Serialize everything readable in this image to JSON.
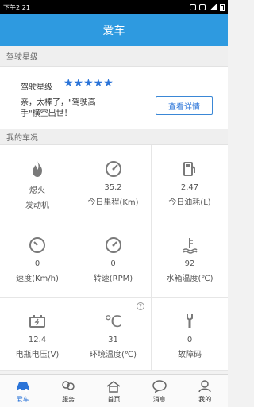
{
  "status_bar": {
    "time": "下午2:21"
  },
  "app_bar": {
    "title": "爱车"
  },
  "sections": {
    "driving_star": "驾驶星级",
    "my_car_status": "我的车况"
  },
  "star_panel": {
    "label": "驾驶星级",
    "stars": "★★★★★",
    "rating": 5,
    "message": "亲，太棒了，\"驾驶高手\"横空出世！",
    "detail_button": "查看详情"
  },
  "metrics": [
    {
      "icon": "flame-icon",
      "value": "熄火",
      "label": "发动机"
    },
    {
      "icon": "speedometer-icon",
      "value": "35.2",
      "label": "今日里程(Km)"
    },
    {
      "icon": "fuel-pump-icon",
      "value": "2.47",
      "label": "今日油耗(L)"
    },
    {
      "icon": "gauge-icon",
      "value": "0",
      "label": "速度(Km/h)"
    },
    {
      "icon": "tachometer-icon",
      "value": "0",
      "label": "转速(RPM)"
    },
    {
      "icon": "coolant-temp-icon",
      "value": "92",
      "label": "水箱温度(℃)"
    },
    {
      "icon": "battery-icon",
      "value": "12.4",
      "label": "电瓶电压(V)"
    },
    {
      "icon": "celsius-icon",
      "value": "31",
      "label": "环境温度(℃)"
    },
    {
      "icon": "wrench-icon",
      "value": "0",
      "label": "故障码"
    }
  ],
  "celsius_glyph": "℃",
  "help_glyph": "?",
  "tabs": [
    {
      "label": "爱车",
      "active": true
    },
    {
      "label": "服务",
      "active": false
    },
    {
      "label": "首页",
      "active": false
    },
    {
      "label": "消息",
      "active": false
    },
    {
      "label": "我的",
      "active": false
    }
  ],
  "colors": {
    "primary": "#2e9ae0",
    "accent": "#2b74d8"
  }
}
